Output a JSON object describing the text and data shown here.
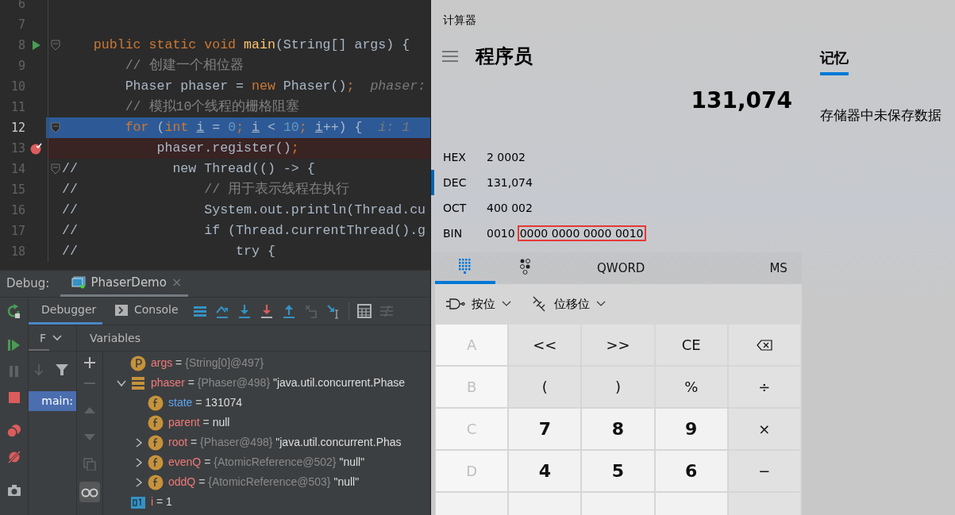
{
  "editor": {
    "lines": [
      {
        "number": "6",
        "kind": "code"
      },
      {
        "number": "7",
        "kind": "code"
      },
      {
        "number": "8",
        "kind": "entry",
        "fold": true,
        "segments": [
          {
            "text": "    public static void ",
            "kind": "kw"
          },
          {
            "text": "main",
            "kind": "method"
          },
          {
            "text": "(String[] args) {",
            "kind": "plain"
          }
        ]
      },
      {
        "number": "9",
        "kind": "code",
        "segments": [
          {
            "text": "        // 创建一个相位器",
            "kind": "comment"
          }
        ]
      },
      {
        "number": "10",
        "kind": "code",
        "segments": [
          {
            "text": "        Phaser phaser = ",
            "kind": "plain"
          },
          {
            "text": "new",
            "kind": "kw"
          },
          {
            "text": " Phaser()",
            "kind": "plain"
          },
          {
            "text": ";",
            "kind": "kw"
          },
          {
            "text": "  phaser:",
            "kind": "hint"
          }
        ]
      },
      {
        "number": "11",
        "kind": "code",
        "segments": [
          {
            "text": "        // 模拟10个线程的栅格阻塞",
            "kind": "comment"
          }
        ]
      },
      {
        "number": "12",
        "kind": "execution",
        "fold": true,
        "segments": [
          {
            "text": "        for",
            "kind": "kw"
          },
          {
            "text": " (",
            "kind": "plain"
          },
          {
            "text": "int ",
            "kind": "kw"
          },
          {
            "text": "i",
            "kind": "var"
          },
          {
            "text": " = ",
            "kind": "plain"
          },
          {
            "text": "0",
            "kind": "num"
          },
          {
            "text": "; ",
            "kind": "kw"
          },
          {
            "text": "i",
            "kind": "var"
          },
          {
            "text": " < ",
            "kind": "plain"
          },
          {
            "text": "10",
            "kind": "num"
          },
          {
            "text": "; ",
            "kind": "kw"
          },
          {
            "text": "i",
            "kind": "var"
          },
          {
            "text": "++) {",
            "kind": "plain"
          },
          {
            "text": "  i: 1",
            "kind": "hint"
          }
        ]
      },
      {
        "number": "13",
        "kind": "breakpoint",
        "segments": [
          {
            "text": "            phaser.register()",
            "kind": "plain"
          },
          {
            "text": ";",
            "kind": "kw"
          }
        ]
      },
      {
        "number": "14",
        "kind": "code",
        "fold": true,
        "segments": [
          {
            "text": "//            new Thread(() -> {",
            "kind": "plain"
          }
        ]
      },
      {
        "number": "15",
        "kind": "code",
        "segments": [
          {
            "text": "//                ",
            "kind": "plain"
          },
          {
            "text": "// 用于表示线程在执行",
            "kind": "comment"
          }
        ]
      },
      {
        "number": "16",
        "kind": "code",
        "segments": [
          {
            "text": "//                System.out.println(Thread.cu",
            "kind": "plain"
          }
        ]
      },
      {
        "number": "17",
        "kind": "code",
        "segments": [
          {
            "text": "//                if (Thread.currentThread().g",
            "kind": "plain"
          }
        ]
      },
      {
        "number": "18",
        "kind": "code",
        "segments": [
          {
            "text": "//                    try {",
            "kind": "plain"
          }
        ]
      }
    ]
  },
  "debug": {
    "label": "Debug:",
    "session_tab": {
      "label": "PhaserDemo",
      "close": "×"
    },
    "tabs": [
      {
        "kind": "debugger",
        "label": "Debugger",
        "selected": true
      },
      {
        "kind": "console",
        "label": "Console",
        "selected": false
      }
    ],
    "frames_header": "F",
    "frames": [
      {
        "label": "main:",
        "selected": true
      }
    ],
    "variables_header": "Variables",
    "variables": [
      {
        "kind": "parameter",
        "segments": [
          {
            "text": "args",
            "kind": "name"
          },
          {
            "text": " = ",
            "kind": "op"
          },
          {
            "text": "{String[0]@497}",
            "kind": "ref"
          }
        ]
      },
      {
        "kind": "array",
        "expanded": true,
        "segments": [
          {
            "text": "phaser",
            "kind": "name"
          },
          {
            "text": " = ",
            "kind": "op"
          },
          {
            "text": "{Phaser@498}",
            "kind": "ref"
          },
          {
            "text": " \"java.util.concurrent.Phase",
            "kind": "str"
          }
        ],
        "children": [
          {
            "kind": "field",
            "segments": [
              {
                "text": "state",
                "kind": "changed"
              },
              {
                "text": " = ",
                "kind": "op"
              },
              {
                "text": "131074",
                "kind": "str"
              }
            ]
          },
          {
            "kind": "field",
            "segments": [
              {
                "text": "parent",
                "kind": "name"
              },
              {
                "text": " = ",
                "kind": "op"
              },
              {
                "text": "null",
                "kind": "str"
              }
            ]
          },
          {
            "kind": "field",
            "expanded": false,
            "segments": [
              {
                "text": "root",
                "kind": "name"
              },
              {
                "text": " = ",
                "kind": "op"
              },
              {
                "text": "{Phaser@498}",
                "kind": "ref"
              },
              {
                "text": " \"java.util.concurrent.Phas",
                "kind": "str"
              }
            ]
          },
          {
            "kind": "field",
            "expanded": false,
            "segments": [
              {
                "text": "evenQ",
                "kind": "name"
              },
              {
                "text": " = ",
                "kind": "op"
              },
              {
                "text": "{AtomicReference@502}",
                "kind": "ref"
              },
              {
                "text": " \"null\"",
                "kind": "str"
              }
            ]
          },
          {
            "kind": "field",
            "expanded": false,
            "segments": [
              {
                "text": "oddQ",
                "kind": "name"
              },
              {
                "text": " = ",
                "kind": "op"
              },
              {
                "text": "{AtomicReference@503}",
                "kind": "ref"
              },
              {
                "text": " \"null\"",
                "kind": "str"
              }
            ]
          }
        ]
      },
      {
        "kind": "primitive",
        "segments": [
          {
            "text": "i",
            "kind": "name"
          },
          {
            "text": " = ",
            "kind": "op"
          },
          {
            "text": "1",
            "kind": "str"
          }
        ]
      }
    ]
  },
  "calculator": {
    "title": "计算器",
    "mode": "程序员",
    "display": "131,074",
    "radix": [
      {
        "label": "HEX",
        "selected": false,
        "parts": [
          {
            "text": "2 0002",
            "boxed": false
          }
        ]
      },
      {
        "label": "DEC",
        "selected": true,
        "parts": [
          {
            "text": "131,074",
            "boxed": false
          }
        ]
      },
      {
        "label": "OCT",
        "selected": false,
        "parts": [
          {
            "text": "400 002",
            "boxed": false
          }
        ]
      },
      {
        "label": "BIN",
        "selected": false,
        "parts": [
          {
            "text": "0010",
            "boxed": false
          },
          {
            "text": "0000 0000 0000 0010",
            "boxed": true
          }
        ]
      }
    ],
    "keypad_tabs": [
      {
        "kind": "keypad",
        "selected": true
      },
      {
        "kind": "bits",
        "selected": false
      }
    ],
    "word_size": "QWORD",
    "memory_store": "MS",
    "menus": [
      {
        "kind": "bitwise",
        "label": "按位"
      },
      {
        "kind": "shift",
        "label": "位移位"
      }
    ],
    "keys": [
      {
        "kind": "hex",
        "label": "A",
        "disabled": true
      },
      {
        "kind": "op",
        "label": "<<",
        "disabled": false
      },
      {
        "kind": "op",
        "label": ">>",
        "disabled": false
      },
      {
        "kind": "op",
        "label": "CE",
        "disabled": false
      },
      {
        "kind": "backspace",
        "disabled": false
      },
      {
        "kind": "hex",
        "label": "B",
        "disabled": true
      },
      {
        "kind": "op",
        "label": "(",
        "disabled": false
      },
      {
        "kind": "op",
        "label": ")",
        "disabled": false
      },
      {
        "kind": "op",
        "label": "%",
        "disabled": false
      },
      {
        "kind": "op",
        "label": "÷",
        "disabled": false
      },
      {
        "kind": "hex",
        "label": "C",
        "disabled": true
      },
      {
        "kind": "digit",
        "label": "7",
        "disabled": false
      },
      {
        "kind": "digit",
        "label": "8",
        "disabled": false
      },
      {
        "kind": "digit",
        "label": "9",
        "disabled": false
      },
      {
        "kind": "op",
        "label": "×",
        "disabled": false
      },
      {
        "kind": "hex",
        "label": "D",
        "disabled": true
      },
      {
        "kind": "digit",
        "label": "4",
        "disabled": false
      },
      {
        "kind": "digit",
        "label": "5",
        "disabled": false
      },
      {
        "kind": "digit",
        "label": "6",
        "disabled": false
      },
      {
        "kind": "op",
        "label": "−",
        "disabled": false
      },
      {
        "kind": "hex"
      },
      {
        "kind": "digit"
      },
      {
        "kind": "digit"
      },
      {
        "kind": "digit"
      },
      {
        "kind": "op"
      }
    ]
  },
  "memory": {
    "tab": "记忆",
    "selected": true,
    "empty_text": "存储器中未保存数据"
  }
}
